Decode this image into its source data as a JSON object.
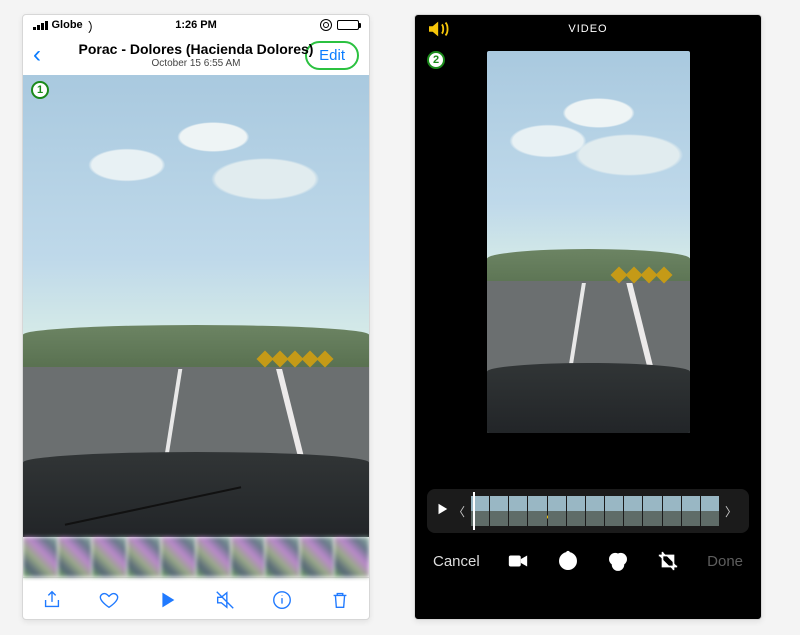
{
  "left": {
    "status": {
      "carrier": "Globe",
      "time": "1:26 PM"
    },
    "nav": {
      "title": "Porac - Dolores (Hacienda Dolores)",
      "subtitle": "October 15  6:55 AM",
      "edit": "Edit"
    }
  },
  "right": {
    "header": "VIDEO",
    "cancel": "Cancel",
    "done": "Done"
  },
  "callouts": {
    "one": "1",
    "two": "2"
  }
}
